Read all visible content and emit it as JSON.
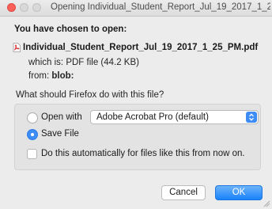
{
  "dialog": {
    "title": "Opening Individual_Student_Report_Jul_19_2017_1_25_P...",
    "prompt": "You have chosen to open:",
    "file_icon": "pdf-file-icon",
    "filename": "Individual_Student_Report_Jul_19_2017_1_25_PM.pdf",
    "which_is_label": "which is:",
    "which_is_value": "PDF file (44.2 KB)",
    "from_label": "from:",
    "from_value": "blob:",
    "question": "What should Firefox do with this file?"
  },
  "options": {
    "open_with_label": "Open with",
    "open_with_app": "Adobe Acrobat Pro (default)",
    "save_file_label": "Save File",
    "selected": "save_file",
    "auto_label": "Do this automatically for files like this from now on.",
    "auto_checked": false
  },
  "buttons": {
    "cancel": "Cancel",
    "ok": "OK"
  },
  "colors": {
    "accent": "#3e8df7",
    "close": "#fc605b",
    "pdf_icon": "#d62c2c"
  }
}
